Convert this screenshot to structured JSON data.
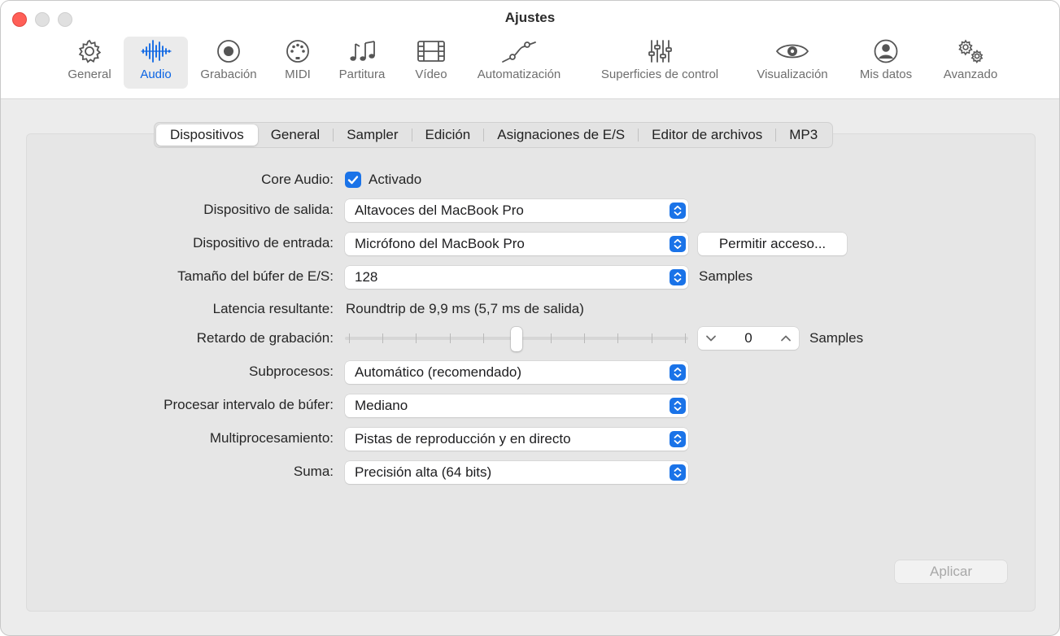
{
  "window": {
    "title": "Ajustes"
  },
  "toolbar": {
    "items": [
      {
        "label": "General",
        "icon": "gear-icon"
      },
      {
        "label": "Audio",
        "icon": "waveform-icon",
        "active": true
      },
      {
        "label": "Grabación",
        "icon": "record-icon"
      },
      {
        "label": "MIDI",
        "icon": "midi-port-icon"
      },
      {
        "label": "Partitura",
        "icon": "music-notes-icon"
      },
      {
        "label": "Vídeo",
        "icon": "film-icon"
      },
      {
        "label": "Automatización",
        "icon": "automation-curve-icon"
      },
      {
        "label": "Superficies de control",
        "icon": "sliders-icon"
      },
      {
        "label": "Visualización",
        "icon": "eye-icon"
      },
      {
        "label": "Mis datos",
        "icon": "person-circle-icon"
      },
      {
        "label": "Avanzado",
        "icon": "gears-icon"
      }
    ],
    "accent": "#0a64e4"
  },
  "tabs": [
    "Dispositivos",
    "General",
    "Sampler",
    "Edición",
    "Asignaciones de E/S",
    "Editor de archivos",
    "MP3"
  ],
  "settings": {
    "core_audio": {
      "label": "Core Audio:",
      "checkbox_label": "Activado",
      "checked": true
    },
    "output_device": {
      "label": "Dispositivo de salida:",
      "value": "Altavoces del MacBook Pro"
    },
    "input_device": {
      "label": "Dispositivo de entrada:",
      "value": "Micrófono del MacBook Pro",
      "button": "Permitir acceso..."
    },
    "buffer_size": {
      "label": "Tamaño del búfer de E/S:",
      "value": "128",
      "unit": "Samples"
    },
    "latency": {
      "label": "Latencia resultante:",
      "value": "Roundtrip de 9,9 ms (5,7 ms de salida)"
    },
    "record_delay": {
      "label": "Retardo de grabación:",
      "value": "0",
      "unit": "Samples",
      "slider_fraction": 0.5
    },
    "threads": {
      "label": "Subprocesos:",
      "value": "Automático (recomendado)"
    },
    "buffer_range": {
      "label": "Procesar intervalo de búfer:",
      "value": "Mediano"
    },
    "multiprocessing": {
      "label": "Multiprocesamiento:",
      "value": "Pistas de reproducción y en directo"
    },
    "summing": {
      "label": "Suma:",
      "value": "Precisión alta (64 bits)"
    }
  },
  "apply_button": "Aplicar",
  "colors": {
    "close": "#ff5f57",
    "accent_blue": "#1a73e8"
  }
}
